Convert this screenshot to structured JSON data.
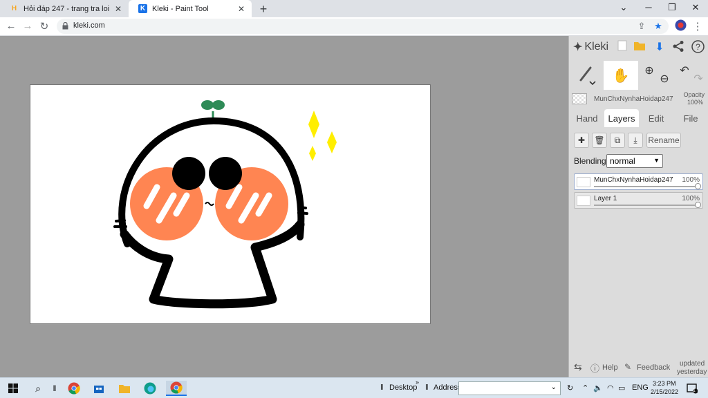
{
  "browser": {
    "tabs": [
      {
        "title": "Hỏi đáp 247 - trang tra loi",
        "favicon": "H",
        "favicon_color": "#f5a623"
      },
      {
        "title": "Kleki - Paint Tool",
        "favicon": "K",
        "favicon_color": "#1a73e8"
      }
    ],
    "url": "kleki.com"
  },
  "app": {
    "logo": "Kleki",
    "header_icons": [
      "new-image-icon",
      "open-folder-icon",
      "download-icon",
      "share-icon",
      "help-icon"
    ],
    "tools": [
      "brush-icon",
      "hand-icon",
      "zoom-in-icon",
      "zoom-out-icon",
      "undo-icon",
      "redo-icon"
    ],
    "layer_header_name": "MunChxNynhaHoidap247",
    "opacity_label": "Opacity",
    "opacity_value": "100%",
    "tabs": [
      "Hand",
      "Layers",
      "Edit",
      "File"
    ],
    "active_tab": "Layers",
    "rename_label": "Rename",
    "blending_label": "Blending",
    "blending_value": "normal",
    "layers": [
      {
        "name": "MunChxNynhaHoidap247",
        "opacity": "100%",
        "opacity_fraction": 1.0,
        "selected": true
      },
      {
        "name": "Layer 1",
        "opacity": "100%",
        "opacity_fraction": 1.0,
        "selected": false
      }
    ],
    "footer": {
      "help": "Help",
      "feedback": "Feedback",
      "updated_line1": "updated",
      "updated_line2": "yesterday"
    }
  },
  "taskbar": {
    "desktop_label": "Desktop",
    "address_label": "Address",
    "language": "ENG",
    "time": "3:23 PM",
    "date": "2/15/2022",
    "notifications": "1"
  },
  "colors": {
    "accent_orange": "#ff8552",
    "sprout_green": "#2e8b57",
    "sparkle_yellow": "#ffee00",
    "tab_inactive": "#dee1e6",
    "workspace_gray": "#9c9c9c"
  }
}
